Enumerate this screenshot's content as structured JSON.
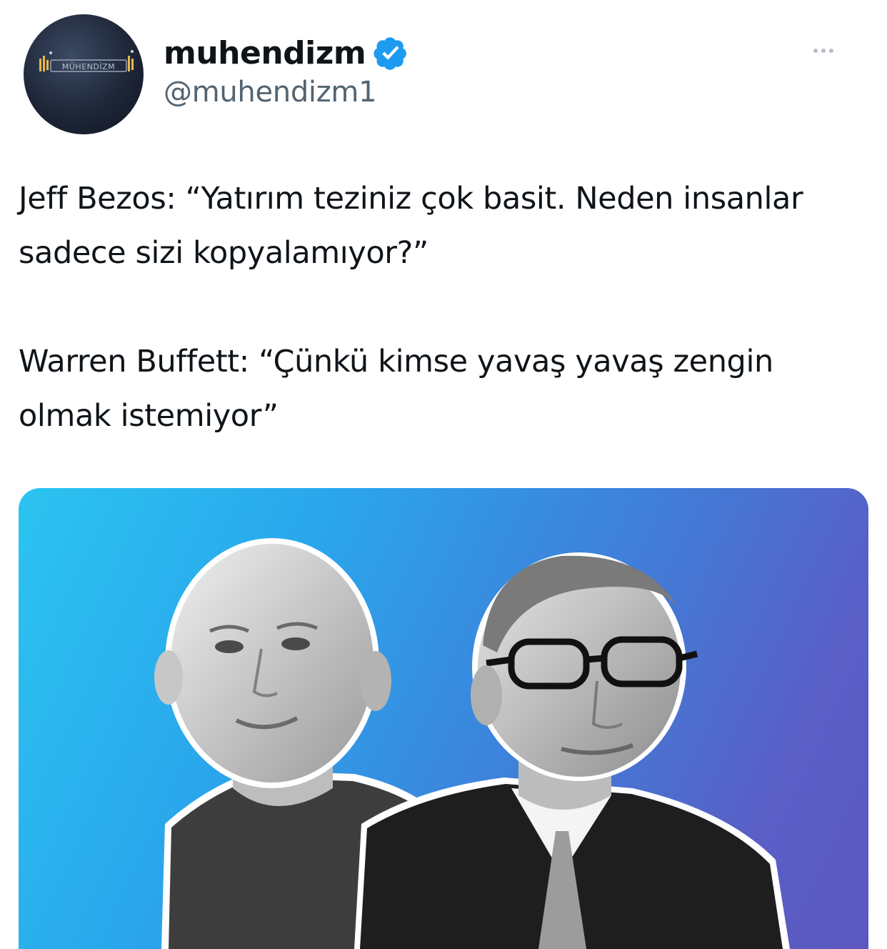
{
  "author": {
    "display_name": "muhendizm",
    "handle": "@muhendizm1",
    "avatar_logo_text": "MÜHENDİZM",
    "verified": true
  },
  "tweet": {
    "paragraphs": [
      "Jeff Bezos: “Yatırım teziniz çok basit. Neden insanlar sadece sizi kopyalamıyor?”",
      "Warren Buffett: “Çünkü kimse yavaş yavaş zengin olmak istemiyor”"
    ]
  },
  "media": {
    "subjects": [
      "left-man-photo",
      "right-man-photo"
    ],
    "background_colors": [
      "#2bc4f0",
      "#5b57c0"
    ]
  },
  "icons": {
    "verified": "verified-badge-icon",
    "more": "more-dots-icon"
  },
  "colors": {
    "text": "#0f1419",
    "secondary_text": "#536471",
    "verified_blue": "#1d9bf0"
  }
}
